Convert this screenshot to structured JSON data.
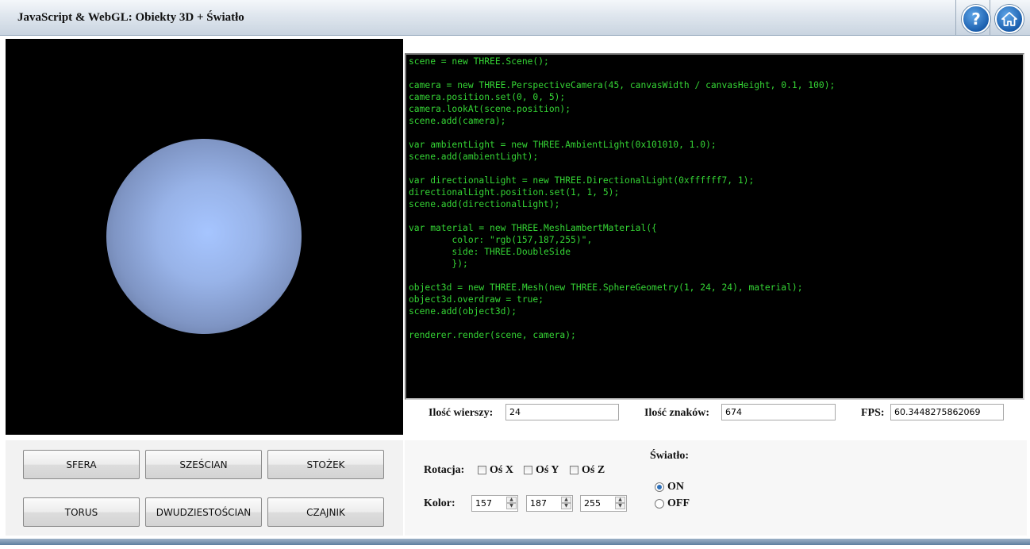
{
  "header": {
    "title": "JavaScript & WebGL: Obiekty 3D + Światło"
  },
  "icons": {
    "help": "help-icon",
    "home": "home-icon"
  },
  "code": {
    "lines": [
      "scene = new THREE.Scene();",
      "",
      "camera = new THREE.PerspectiveCamera(45, canvasWidth / canvasHeight, 0.1, 100);",
      "camera.position.set(0, 0, 5);",
      "camera.lookAt(scene.position);",
      "scene.add(camera);",
      "",
      "var ambientLight = new THREE.AmbientLight(0x101010, 1.0);",
      "scene.add(ambientLight);",
      "",
      "var directionalLight = new THREE.DirectionalLight(0xffffff7, 1);",
      "directionalLight.position.set(1, 1, 5);",
      "scene.add(directionalLight);",
      "",
      "var material = new THREE.MeshLambertMaterial({",
      "        color: \"rgb(157,187,255)\",",
      "        side: THREE.DoubleSide",
      "        });",
      "",
      "object3d = new THREE.Mesh(new THREE.SphereGeometry(1, 24, 24), material);",
      "object3d.overdraw = true;",
      "scene.add(object3d);",
      "",
      "renderer.render(scene, camera);"
    ]
  },
  "stats": {
    "rows_label": "Ilość wierszy:",
    "rows_value": "24",
    "chars_label": "Ilość znaków:",
    "chars_value": "674",
    "fps_label": "FPS:",
    "fps_value": "60.3448275862069"
  },
  "shapes": {
    "sfera": "SFERA",
    "szescian": "SZEŚCIAN",
    "stozek": "STOŻEK",
    "torus": "TORUS",
    "dwudziestoscian": "DWUDZIESTOŚCIAN",
    "czajnik": "CZAJNIK"
  },
  "controls": {
    "rotation_label": "Rotacja:",
    "axis_x": "Oś X",
    "axis_y": "Oś Y",
    "axis_z": "Oś Z",
    "color_label": "Kolor:",
    "color_r": "157",
    "color_g": "187",
    "color_b": "255",
    "light_label": "Światło:",
    "light_on": "ON",
    "light_off": "OFF",
    "light_selected": "ON"
  },
  "colors": {
    "sphere": "#9dbbff",
    "code_text": "#35d535",
    "code_bg": "#000000"
  }
}
